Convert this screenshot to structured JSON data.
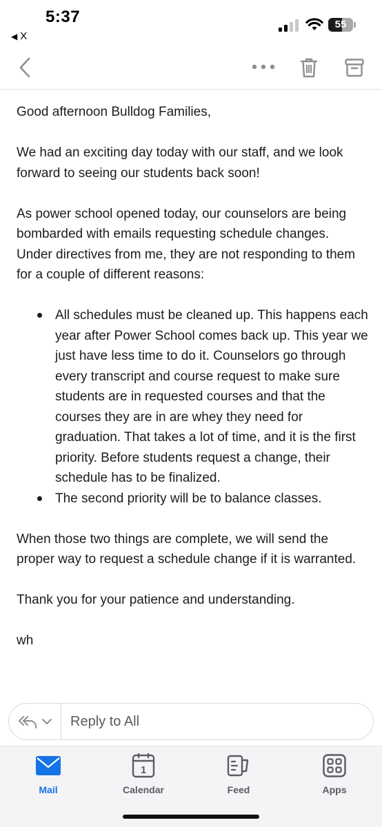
{
  "status_bar": {
    "time": "5:37",
    "back_app_label": "X",
    "battery_level": "55"
  },
  "toolbar": {
    "back_icon": "chevron-left-icon",
    "more_icon": "more-horizontal-icon",
    "delete_icon": "trash-icon",
    "archive_icon": "archive-icon"
  },
  "email": {
    "greeting": "Good afternoon Bulldog Families,",
    "paragraph1": "We had an exciting day today with our staff, and we look forward to seeing our students back soon!",
    "paragraph2": "As power school opened today, our counselors are being bombarded with emails requesting schedule changes.  Under directives from me, they are not responding to them for a couple of different reasons:",
    "bullets": [
      "All schedules must be cleaned up.  This happens each year after Power School comes back up.  This year we just have less time to do it.  Counselors go through every transcript and course request to make sure students are in requested courses and that the courses they are in are whey they need for graduation.  That takes a lot of time, and it is the first priority.  Before students request a change, their schedule has to be finalized.",
      "The second priority will be to balance classes."
    ],
    "paragraph3": "When those two things are complete, we will send the proper way to request a schedule change if it is warranted.",
    "closing": "Thank you for your patience and understanding.",
    "signature": "wh"
  },
  "reply": {
    "label": "Reply to All"
  },
  "tabs": [
    {
      "label": "Mail",
      "icon": "mail-icon",
      "active": true
    },
    {
      "label": "Calendar",
      "icon": "calendar-icon",
      "day": "1",
      "active": false
    },
    {
      "label": "Feed",
      "icon": "feed-icon",
      "active": false
    },
    {
      "label": "Apps",
      "icon": "apps-icon",
      "active": false
    }
  ],
  "colors": {
    "accent": "#1473e6",
    "icon_gray": "#8e8e93",
    "text": "#1c1c1e"
  }
}
